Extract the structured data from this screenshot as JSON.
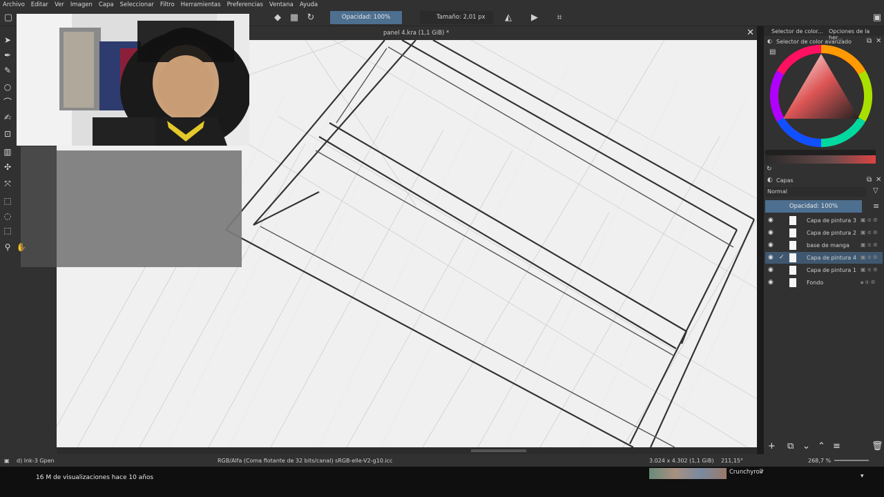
{
  "menu": [
    "Archivo",
    "Editar",
    "Ver",
    "Imagen",
    "Capa",
    "Seleccionar",
    "Filtro",
    "Herramientas",
    "Preferencias",
    "Ventana",
    "Ayuda"
  ],
  "toolbar": {
    "opacity_label": "Opacidad: 100%",
    "size_label": "Tamaño: 2,01 px"
  },
  "document": {
    "title": "panel 4.kra (1,1 GiB) *"
  },
  "dock": {
    "tab_color_selector": "Selector de color...",
    "tab_tool_options": "Opciones de la her...",
    "advanced_color_title": "Selector de color avanzado"
  },
  "layers": {
    "panel_title": "Capas",
    "blend_mode": "Normal",
    "opacity_label": "Opacidad:  100%",
    "items": [
      {
        "name": "Capa de pintura 3",
        "selected": false
      },
      {
        "name": "Capa de pintura 2",
        "selected": false
      },
      {
        "name": "base de manga",
        "selected": false
      },
      {
        "name": "Capa de pintura 4",
        "selected": true
      },
      {
        "name": "Capa de pintura 1",
        "selected": false
      },
      {
        "name": "Fondo",
        "selected": false
      }
    ]
  },
  "status": {
    "brush": "d) Ink-3 Gpen",
    "color_profile": "RGB/Alfa (Coma flotante de 32 bits/canal)  sRGB-elle-V2-g10.icc",
    "dimensions": "3.024 x 4.302 (1,1 GiB)",
    "rotation": "211,15°",
    "zoom": "268,7 %"
  },
  "youtube": {
    "views": "16 M de visualizaciones  hace 10 años",
    "channel": "Crunchyroll"
  }
}
